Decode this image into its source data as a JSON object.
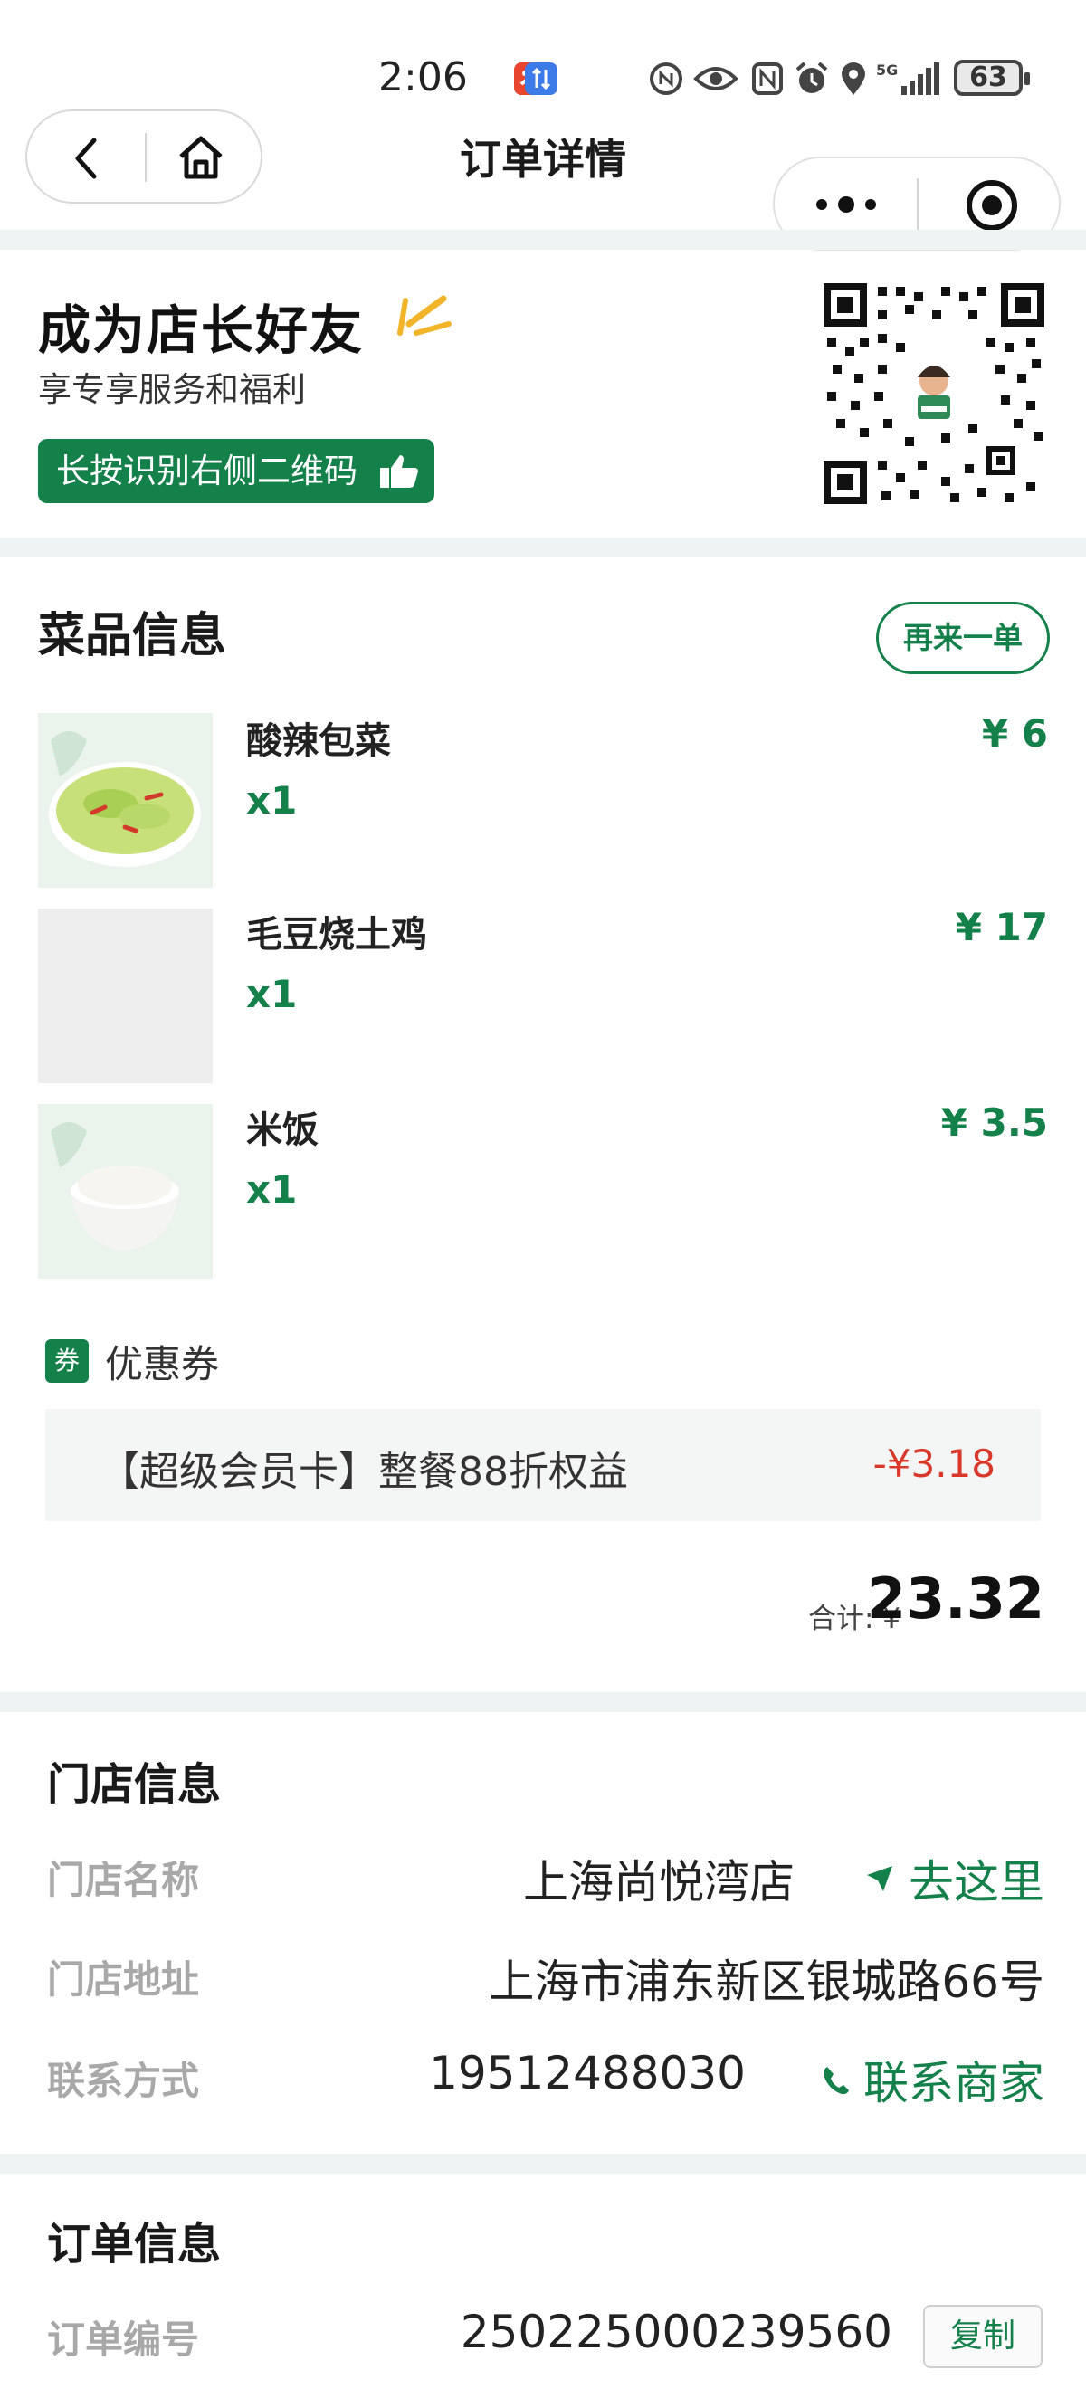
{
  "status_bar": {
    "time": "2:06",
    "battery": "63"
  },
  "nav": {
    "title": "订单详情"
  },
  "promo": {
    "title": "成为店长好友",
    "subtitle": "享专享服务和福利",
    "button_label": "长按识别右侧二维码"
  },
  "dishes": {
    "section_title": "菜品信息",
    "reorder_label": "再来一单",
    "items": [
      {
        "name": "酸辣包菜",
        "qty": "x1",
        "price": "¥ 6"
      },
      {
        "name": "毛豆烧土鸡",
        "qty": "x1",
        "price": "¥ 17"
      },
      {
        "name": "米饭",
        "qty": "x1",
        "price": "¥ 3.5"
      }
    ]
  },
  "coupon": {
    "badge": "券",
    "title": "优惠券",
    "name": "【超级会员卡】整餐88折权益",
    "amount": "-¥3.18"
  },
  "total": {
    "label": "合计: ¥",
    "value": "23.32"
  },
  "store": {
    "section_title": "门店信息",
    "rows": [
      {
        "label": "门店名称",
        "value": "上海尚悦湾店",
        "action": "去这里"
      },
      {
        "label": "门店地址",
        "value": "上海市浦东新区银城路66号"
      },
      {
        "label": "联系方式",
        "value": "19512488030",
        "action": "联系商家"
      }
    ]
  },
  "order": {
    "section_title": "订单信息",
    "rows": [
      {
        "label": "订单编号",
        "value": "250225000239560",
        "action": "复制"
      }
    ]
  },
  "colors": {
    "accent": "#14804a",
    "discount": "#d8372a",
    "separator": "#eef3f3"
  }
}
